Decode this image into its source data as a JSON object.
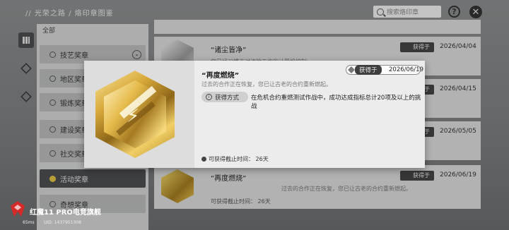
{
  "topbar": {
    "breadcrumb": "// 光荣之路 / 烙印章图鉴",
    "search_placeholder": "搜索烙印章",
    "help_label": "?",
    "close_label": "✕"
  },
  "categories": {
    "all_label": "全部",
    "items": [
      {
        "label": "技艺奖章",
        "active": false
      },
      {
        "label": "地区奖章",
        "active": false
      },
      {
        "label": "锻炼奖章",
        "active": false
      },
      {
        "label": "建设奖章",
        "active": false
      },
      {
        "label": "社交奖章",
        "active": false
      },
      {
        "label": "活动奖章",
        "active": true
      },
      {
        "label": "奇想奖章",
        "active": false
      }
    ]
  },
  "cards": [
    {
      "title": "",
      "got": "",
      "date": ""
    },
    {
      "title": "“诸尘皆净”",
      "got": "获得于",
      "date": "2026/04/04",
      "desc": "您已经习惯于对清除工作的计算机控制"
    },
    {
      "title": "",
      "got": "获得于",
      "date": "2026/04/15"
    },
    {
      "title": "",
      "got": "获得于",
      "date": "2026/05/05"
    },
    {
      "title": "“再度燃烧”",
      "got": "获得于",
      "date": "2026/06/19",
      "desc": "过去的合作正在恢复，您已让古老的合约重新燃起。",
      "deadline": "可获得截止时间：  26天"
    }
  ],
  "popup": {
    "title": "“再度燃烧”",
    "desc": "过去的合作正在恢复，您已让古老的合约重新燃起。",
    "got_label": "获得于",
    "date": "2026/06/19",
    "acquire_button": "获得方式",
    "acquire_text": "在危机合约重燃测试作战中，成功达成指标总计20项及以上的挑战",
    "deadline": "可获得截止时间：  26天"
  },
  "watermark": {
    "brand": "红魔11 PRO电竞旗舰",
    "ping": "65ms",
    "uid": "UID: 1437951308"
  },
  "colors": {
    "accent_gold": "#e8c640",
    "dark_tab": "#4a4c4e"
  }
}
